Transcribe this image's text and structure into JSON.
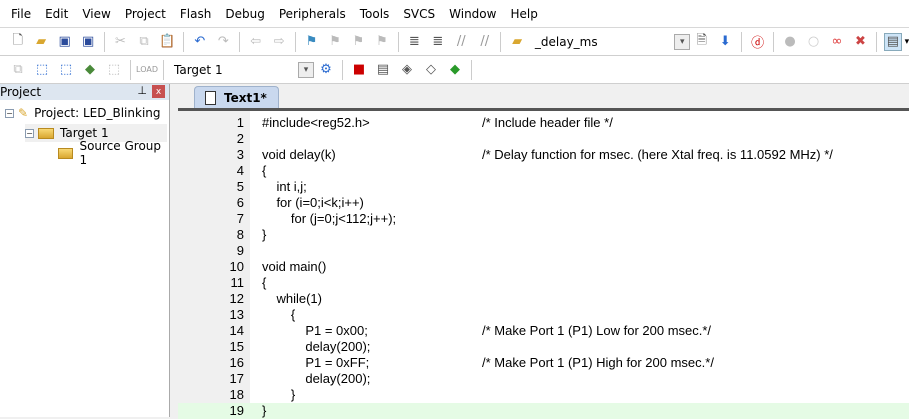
{
  "menu": [
    "File",
    "Edit",
    "View",
    "Project",
    "Flash",
    "Debug",
    "Peripherals",
    "Tools",
    "SVCS",
    "Window",
    "Help"
  ],
  "toolbar": {
    "find_value": "_delay_ms",
    "target_value": "Target 1"
  },
  "project_panel": {
    "title": "Project",
    "root": "Project: LED_Blinking",
    "target": "Target 1",
    "group": "Source Group 1"
  },
  "editor": {
    "tab": "Text1*",
    "lines": [
      {
        "n": "1",
        "code": "#include<reg52.h>",
        "comment": "/* Include header file */"
      },
      {
        "n": "2",
        "code": "",
        "comment": ""
      },
      {
        "n": "3",
        "code": "void delay(k)",
        "comment": "/* Delay function for msec. (here Xtal freq. is 11.0592 MHz) */"
      },
      {
        "n": "4",
        "code": "{",
        "comment": ""
      },
      {
        "n": "5",
        "code": "    int i,j;",
        "comment": ""
      },
      {
        "n": "6",
        "code": "    for (i=0;i<k;i++)",
        "comment": ""
      },
      {
        "n": "7",
        "code": "        for (j=0;j<112;j++);",
        "comment": ""
      },
      {
        "n": "8",
        "code": "}",
        "comment": ""
      },
      {
        "n": "9",
        "code": "",
        "comment": ""
      },
      {
        "n": "10",
        "code": "void main()",
        "comment": ""
      },
      {
        "n": "11",
        "code": "{",
        "comment": ""
      },
      {
        "n": "12",
        "code": "    while(1)",
        "comment": ""
      },
      {
        "n": "13",
        "code": "        {",
        "comment": ""
      },
      {
        "n": "14",
        "code": "            P1 = 0x00;",
        "comment": "/* Make Port 1 (P1) Low for 200 msec.*/"
      },
      {
        "n": "15",
        "code": "            delay(200);",
        "comment": ""
      },
      {
        "n": "16",
        "code": "            P1 = 0xFF;",
        "comment": "/* Make Port 1 (P1) High for 200 msec.*/"
      },
      {
        "n": "17",
        "code": "            delay(200);",
        "comment": ""
      },
      {
        "n": "18",
        "code": "        }",
        "comment": ""
      },
      {
        "n": "19",
        "code": "}",
        "comment": ""
      }
    ]
  }
}
